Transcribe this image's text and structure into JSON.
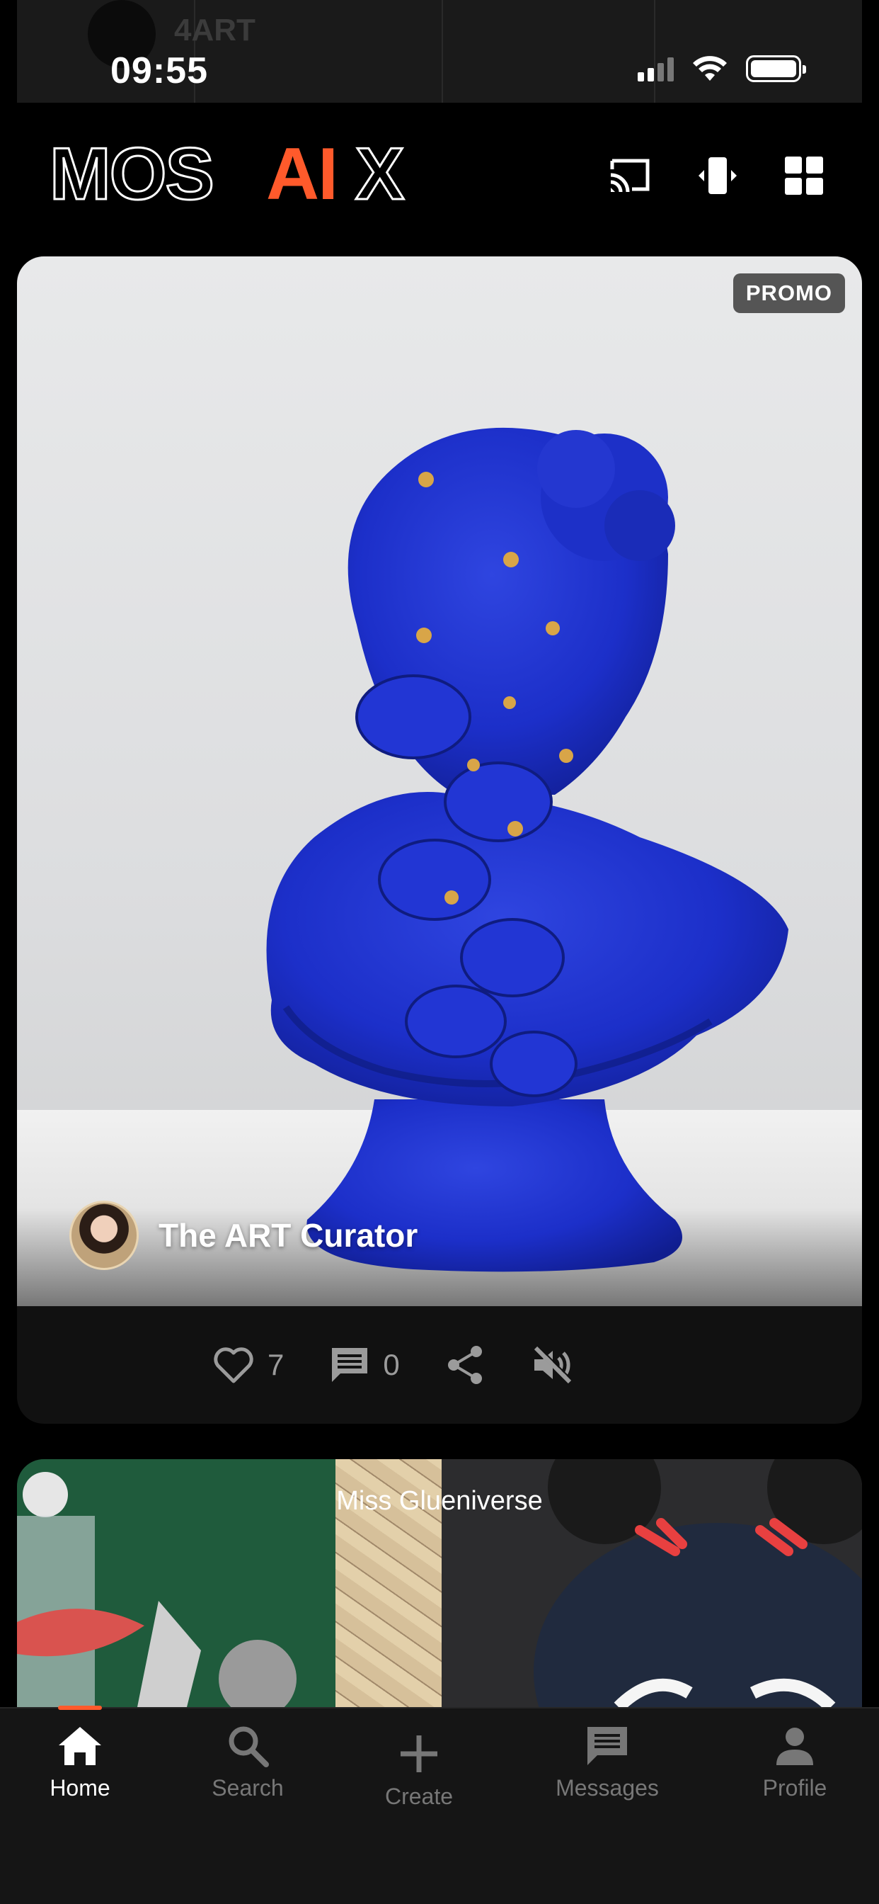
{
  "status_bar": {
    "time": "09:55",
    "background_app_name": "4ART"
  },
  "app": {
    "brand_prefix": "MOS",
    "brand_accent": "AI",
    "brand_suffix": "X",
    "accent_color": "#FF5A2B"
  },
  "header": {
    "icons": [
      "cast-icon",
      "swipe-view-icon",
      "grid-view-icon"
    ]
  },
  "post": {
    "badge": "PROMO",
    "author_name": "The ART Curator",
    "likes": "7",
    "comments": "0",
    "icons": [
      "heart-icon",
      "comment-icon",
      "share-icon",
      "mute-icon"
    ]
  },
  "post2": {
    "title": "Miss Glueniverse"
  },
  "nav": {
    "items": [
      {
        "label": "Home",
        "icon": "home-icon",
        "active": true
      },
      {
        "label": "Search",
        "icon": "search-icon",
        "active": false
      },
      {
        "label": "Create",
        "icon": "plus-icon",
        "active": false
      },
      {
        "label": "Messages",
        "icon": "messages-icon",
        "active": false
      },
      {
        "label": "Profile",
        "icon": "profile-icon",
        "active": false
      }
    ]
  }
}
